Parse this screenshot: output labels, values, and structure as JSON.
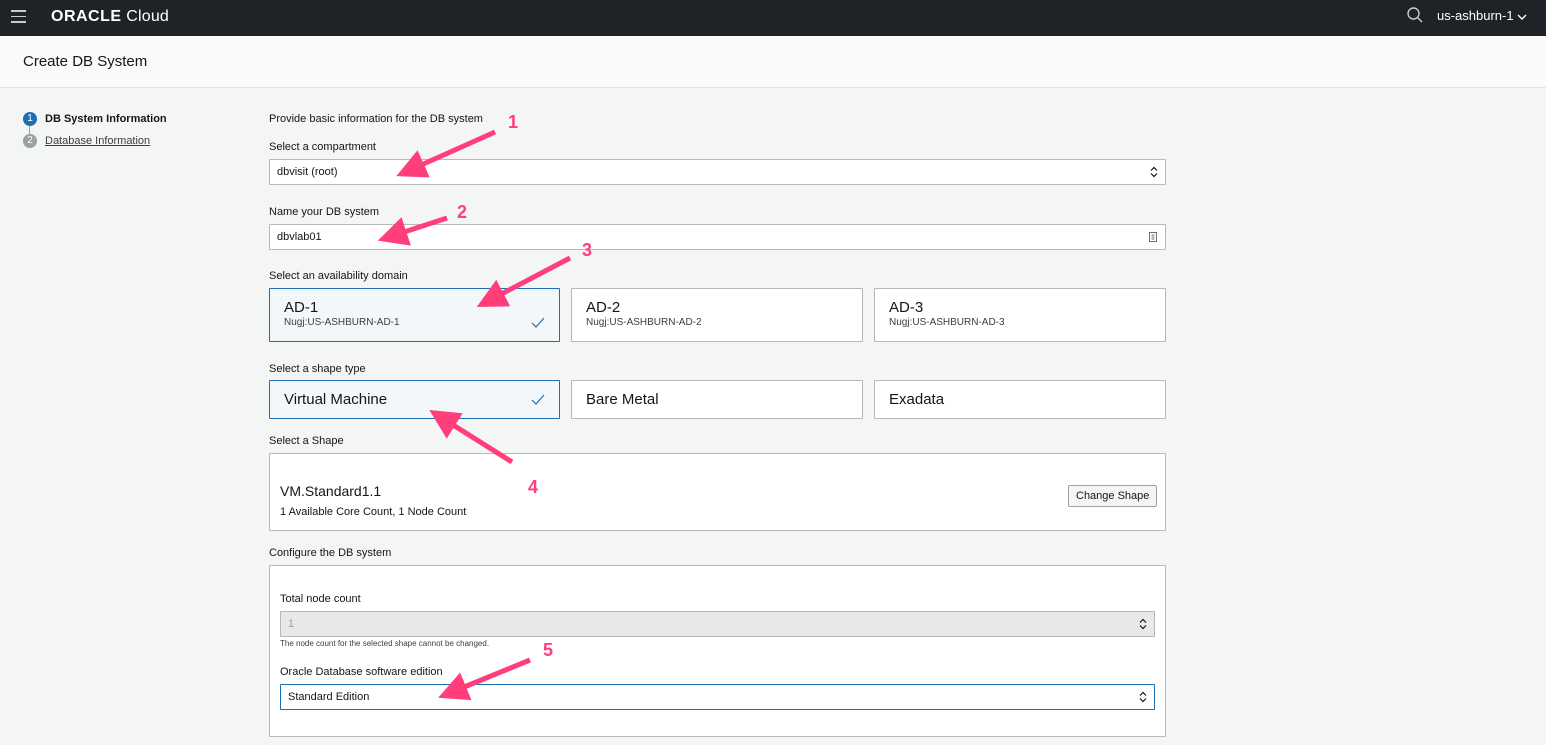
{
  "topbar": {
    "logo_brand": "ORACLE",
    "logo_product": "Cloud",
    "region": "us-ashburn-1"
  },
  "header": {
    "title": "Create DB System"
  },
  "steps": [
    {
      "num": "1",
      "label": "DB System Information"
    },
    {
      "num": "2",
      "label": "Database Information"
    }
  ],
  "form": {
    "intro": "Provide basic information for the DB system",
    "compartment": {
      "label": "Select a compartment",
      "value": "dbvisit (root)"
    },
    "name": {
      "label": "Name your DB system",
      "value": "dbvlab01"
    },
    "availability": {
      "label": "Select an availability domain",
      "options": [
        {
          "title": "AD-1",
          "subtitle": "Nugj:US-ASHBURN-AD-1",
          "selected": true
        },
        {
          "title": "AD-2",
          "subtitle": "Nugj:US-ASHBURN-AD-2",
          "selected": false
        },
        {
          "title": "AD-3",
          "subtitle": "Nugj:US-ASHBURN-AD-3",
          "selected": false
        }
      ]
    },
    "shape_type": {
      "label": "Select a shape type",
      "options": [
        {
          "title": "Virtual Machine",
          "selected": true
        },
        {
          "title": "Bare Metal",
          "selected": false
        },
        {
          "title": "Exadata",
          "selected": false
        }
      ]
    },
    "shape": {
      "label": "Select a Shape",
      "name": "VM.Standard1.1",
      "details": "1 Available Core Count, 1 Node Count",
      "change_button": "Change Shape"
    },
    "configure": {
      "label": "Configure the DB system",
      "node_count": {
        "label": "Total node count",
        "value": "1",
        "help": "The node count for the selected shape cannot be changed."
      },
      "edition": {
        "label": "Oracle Database software edition",
        "value": "Standard Edition"
      }
    }
  },
  "annotations": [
    "1",
    "2",
    "3",
    "4",
    "5"
  ],
  "colors": {
    "accent": "#1d6fb5",
    "annotation": "#ff3e7a",
    "topbar": "#1f2328"
  }
}
